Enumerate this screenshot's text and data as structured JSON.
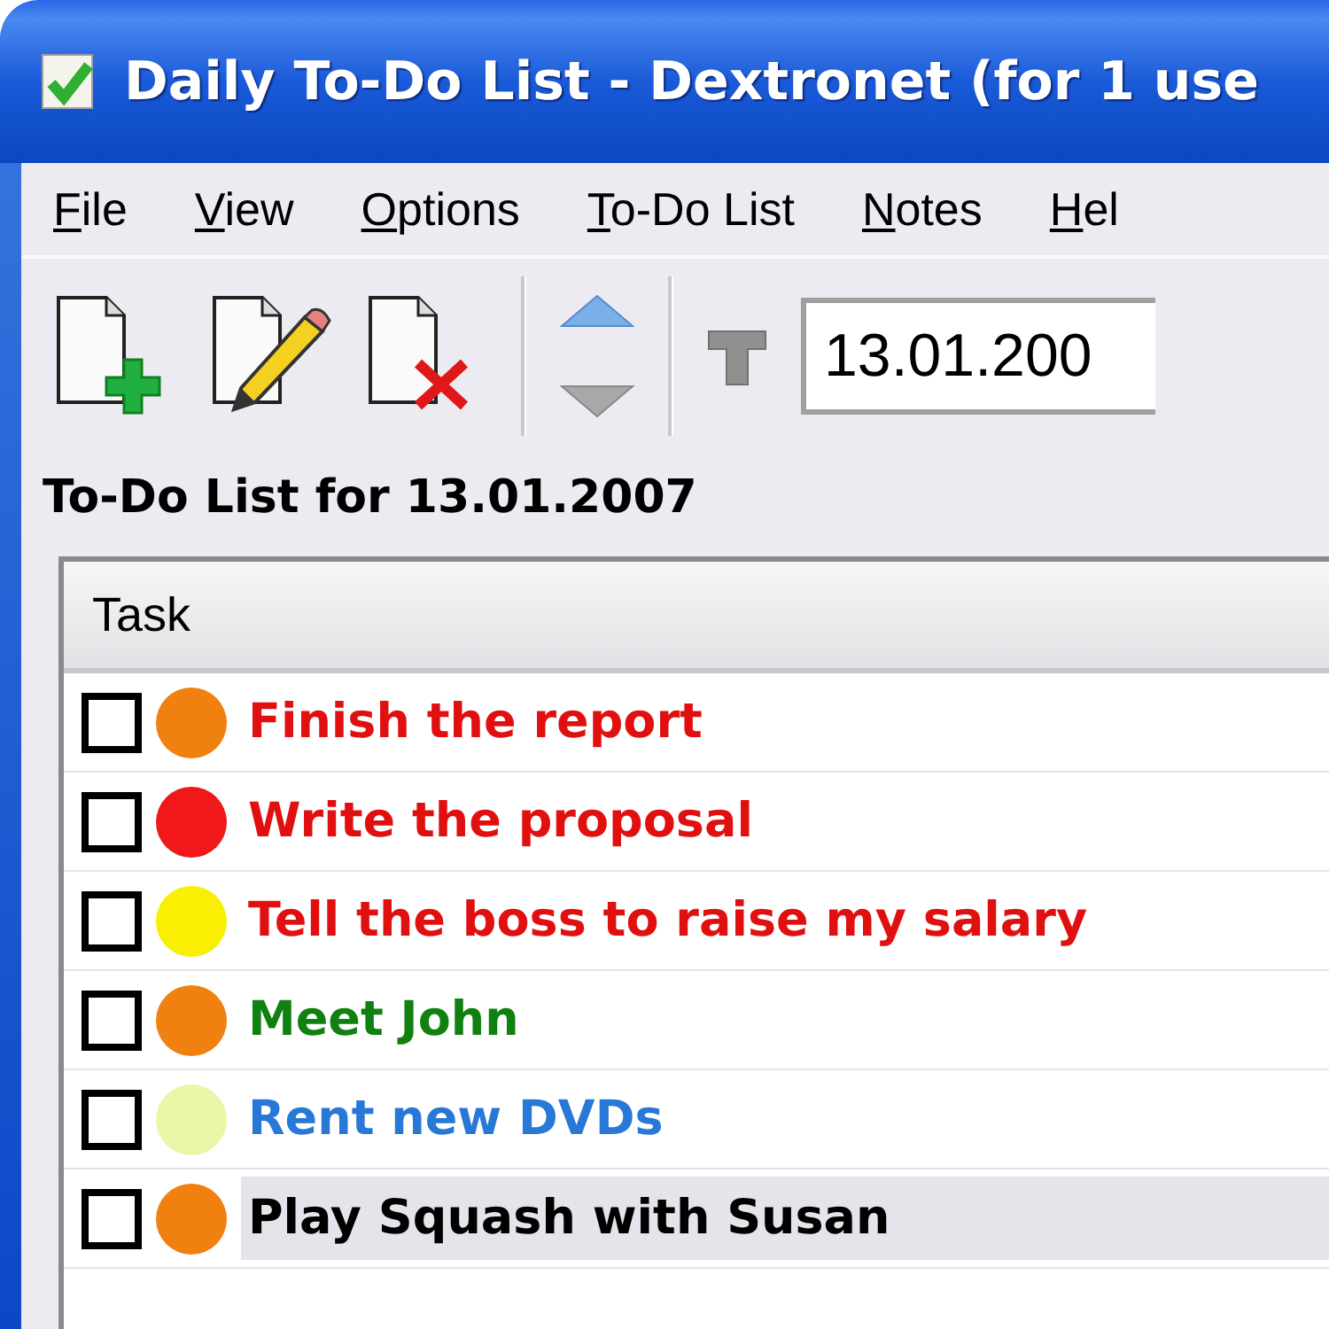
{
  "window": {
    "title": "Daily To-Do List - Dextronet (for 1 use"
  },
  "menu": [
    {
      "label": "File"
    },
    {
      "label": "View"
    },
    {
      "label": "Options"
    },
    {
      "label": "To-Do List"
    },
    {
      "label": "Notes"
    },
    {
      "label": "Hel"
    }
  ],
  "toolbar": {
    "tools": [
      {
        "kind": "new"
      },
      {
        "kind": "edit"
      },
      {
        "kind": "delete"
      },
      {
        "kind": "separator"
      },
      {
        "kind": "up"
      },
      {
        "kind": "separator"
      },
      {
        "kind": "today"
      }
    ],
    "date_field": {
      "value": "13.01.200"
    }
  },
  "list_heading": "To-Do List for 13.01.2007",
  "table": {
    "columns": [
      "Task"
    ],
    "rows": [
      {
        "checked": false,
        "dot": {
          "color": "#f08010"
        },
        "label": {
          "text": "Finish the report",
          "color": "#e01010"
        },
        "selected": false
      },
      {
        "checked": false,
        "dot": {
          "color": "#f01818"
        },
        "label": {
          "text": "Write the proposal",
          "color": "#e01010"
        },
        "selected": false
      },
      {
        "checked": false,
        "dot": {
          "color": "#f8f000"
        },
        "label": {
          "text": "Tell the boss to raise my salary",
          "color": "#e01010"
        },
        "selected": false
      },
      {
        "checked": false,
        "dot": {
          "color": "#f08010"
        },
        "label": {
          "text": "Meet John",
          "color": "#108010"
        },
        "selected": false
      },
      {
        "checked": false,
        "dot": {
          "color": "#e8f8a8"
        },
        "label": {
          "text": "Rent new DVDs",
          "color": "#2878d8"
        },
        "selected": false
      },
      {
        "checked": false,
        "dot": {
          "color": "#f08010"
        },
        "label": {
          "text": "Play Squash with Susan",
          "color": "#000000"
        },
        "selected": true
      }
    ]
  }
}
